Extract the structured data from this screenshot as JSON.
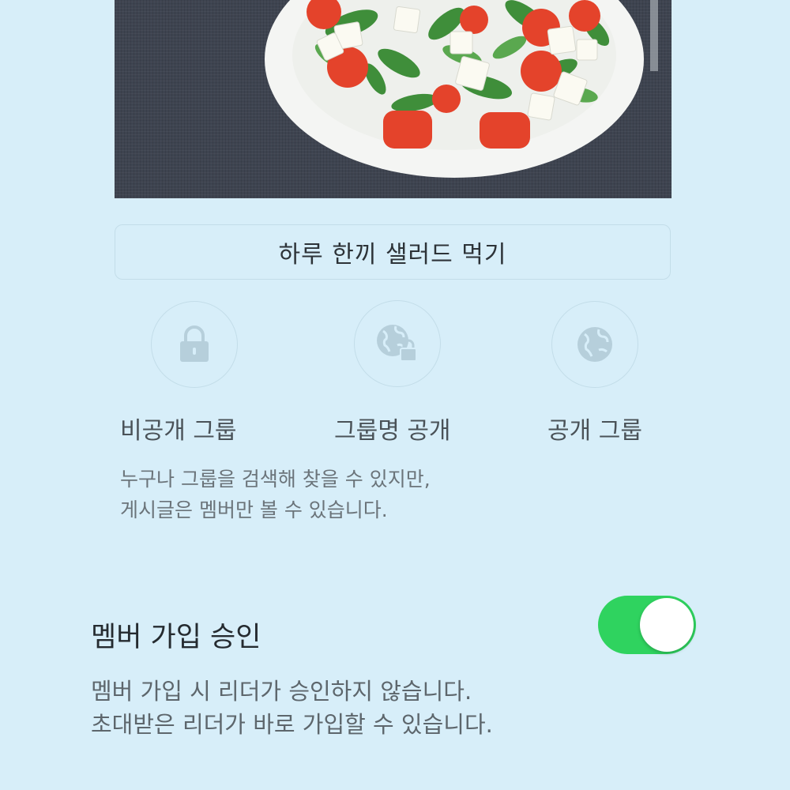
{
  "group": {
    "name": "하루 한끼 샐러드 먹기"
  },
  "privacy": {
    "options": [
      {
        "label": "비공개 그룹",
        "icon": "lock-icon"
      },
      {
        "label": "그룹명 공개",
        "icon": "globe-lock-icon"
      },
      {
        "label": "공개 그룹",
        "icon": "globe-icon"
      }
    ],
    "description_lines": [
      "누구나 그룹을 검색해 찾을 수 있지만,",
      "게시글은 멤버만 볼 수 있습니다."
    ]
  },
  "approval": {
    "title": "멤버 가입 승인",
    "enabled": true,
    "description_lines": [
      "멤버 가입 시 리더가 승인하지 않습니다.",
      "초대받은 리더가 바로 가입할 수 있습니다."
    ]
  },
  "colors": {
    "background": "#d7eef9",
    "toggle_on": "#2fd35f",
    "border": "#c3dde9"
  }
}
